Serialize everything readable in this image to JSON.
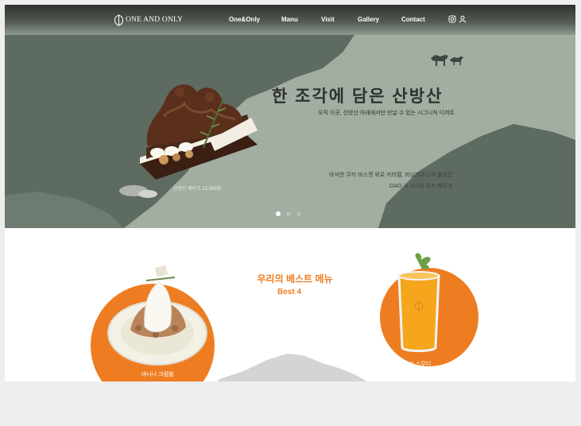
{
  "header": {
    "logo_text": "ONE AND ONLY",
    "nav": [
      "One&Only",
      "Manu",
      "Visit",
      "Gallery",
      "Contact"
    ],
    "icons": [
      "instagram-icon",
      "user-icon"
    ]
  },
  "hero": {
    "title": "한 조각에 담은 산방산",
    "subtitle": "오직 이곳, 산방산 아래에서만 만날 수 있는 시그니처 디저트",
    "desc_line1": "바삭한 쿠키 비스켓 위로 카라멜, 바닐라무스가 들어간",
    "desc_line2": "OAO 시그니처 무스 케이크",
    "cake_caption": "산방산 케이크 12,000원",
    "slides": 3,
    "active_slide": 1
  },
  "best": {
    "title": "우리의 베스트 메뉴",
    "subtitle": "Best 4",
    "items": [
      {
        "label": "바나나 크럼블"
      },
      {
        "label": "망고 스무디"
      }
    ]
  },
  "colors": {
    "accent": "#ee7d22",
    "hero_bg": "#8d9a8e",
    "dark_green": "#5d6a60"
  }
}
